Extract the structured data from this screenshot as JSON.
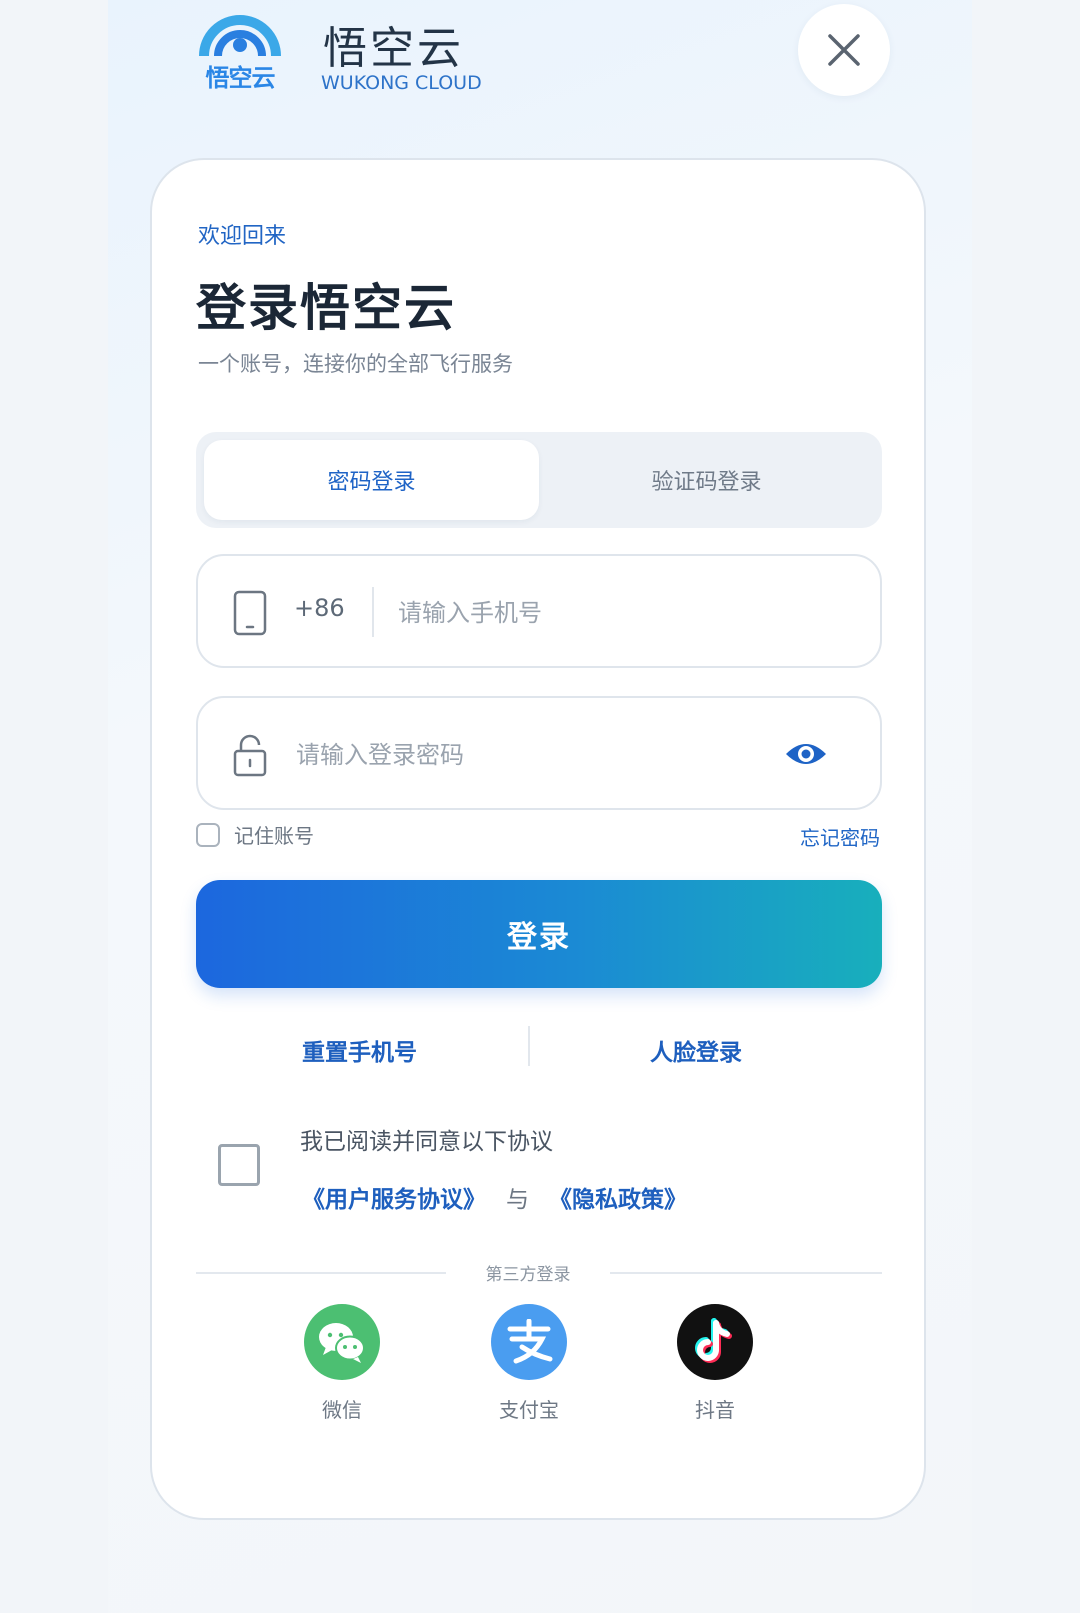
{
  "brand": {
    "logo_text": "悟空云",
    "name_cn": "悟空云",
    "name_en": "WUKONG CLOUD"
  },
  "header": {
    "close_icon": "close-icon"
  },
  "login": {
    "welcome": "欢迎回来",
    "title": "登录悟空云",
    "subtitle": "一个账号，连接你的全部飞行服务",
    "tabs": [
      {
        "label": "密码登录",
        "active": true
      },
      {
        "label": "验证码登录",
        "active": false
      }
    ],
    "phone_field": {
      "country_code": "+86",
      "placeholder": "请输入手机号",
      "value": "",
      "icon": "phone-icon"
    },
    "password_field": {
      "placeholder": "请输入登录密码",
      "value": "",
      "icon": "lock-icon",
      "toggle_icon": "eye-icon"
    },
    "remember_label": "记住账号",
    "remember_checked": false,
    "forgot_label": "忘记密码",
    "submit_label": "登录",
    "alt_links": [
      "重置手机号",
      "人脸登录"
    ],
    "agreement": {
      "checked": false,
      "text": "我已阅读并同意以下协议",
      "user_agreement": "《用户服务协议》",
      "and": "与",
      "privacy_policy": "《隐私政策》"
    },
    "third_party": {
      "title": "第三方登录",
      "providers": [
        {
          "label": "微信",
          "icon": "wechat-icon",
          "color": "#4cbf72"
        },
        {
          "label": "支付宝",
          "icon": "alipay-icon",
          "color": "#4a9df0"
        },
        {
          "label": "抖音",
          "icon": "douyin-icon",
          "color": "#111111"
        }
      ]
    }
  },
  "colors": {
    "accent": "#1e63c6",
    "button_gradient_start": "#1c67de",
    "button_gradient_end": "#18afbc"
  }
}
